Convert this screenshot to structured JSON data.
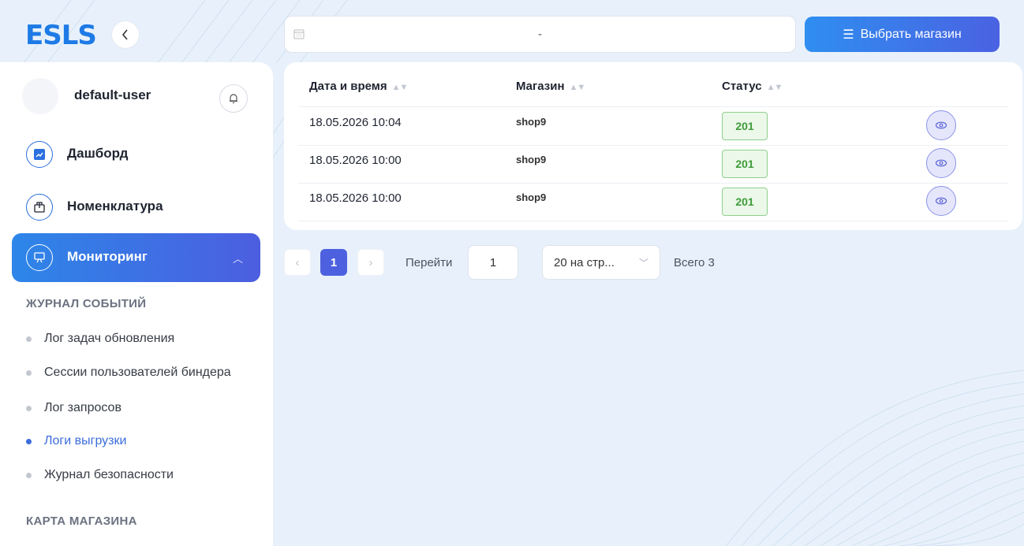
{
  "brand": {
    "logo": "ESLS",
    "collapse_icon": "chevron-left-icon"
  },
  "user": {
    "name": "default-user"
  },
  "nav": {
    "items": [
      {
        "label": "Дашборд",
        "icon": "chart-icon"
      },
      {
        "label": "Номенклатура",
        "icon": "box-icon"
      },
      {
        "label": "Мониторинг",
        "icon": "monitor-icon",
        "active": true
      }
    ]
  },
  "sections": {
    "journal_title": "ЖУРНАЛ СОБЫТИЙ",
    "journal_items": [
      "Лог задач обновления",
      "Сессии пользователей биндера",
      "Лог запросов",
      "Логи выгрузки",
      "Журнал безопасности"
    ],
    "active_journal_item": "Логи выгрузки",
    "map_title": "КАРТА МАГАЗИНА"
  },
  "toolbar": {
    "date_value": "-",
    "select_shop_label": "Выбрать магазин"
  },
  "table": {
    "headers": [
      "Дата и время",
      "Магазин",
      "Статус"
    ],
    "rows": [
      {
        "date": "18.05.2026 10:04",
        "shop": "shop9",
        "status": "201"
      },
      {
        "date": "18.05.2026 10:00",
        "shop": "shop9",
        "status": "201"
      },
      {
        "date": "18.05.2026 10:00",
        "shop": "shop9",
        "status": "201"
      }
    ]
  },
  "pagination": {
    "current_page": "1",
    "goto_label": "Перейти",
    "goto_value": "1",
    "page_size": "20 на стр...",
    "total": "Всего 3"
  },
  "colors": {
    "accent": "#2f8ef0",
    "accent_end": "#4a62e2",
    "status_ok": "#3e9b3a",
    "background": "#e8f1fb"
  }
}
